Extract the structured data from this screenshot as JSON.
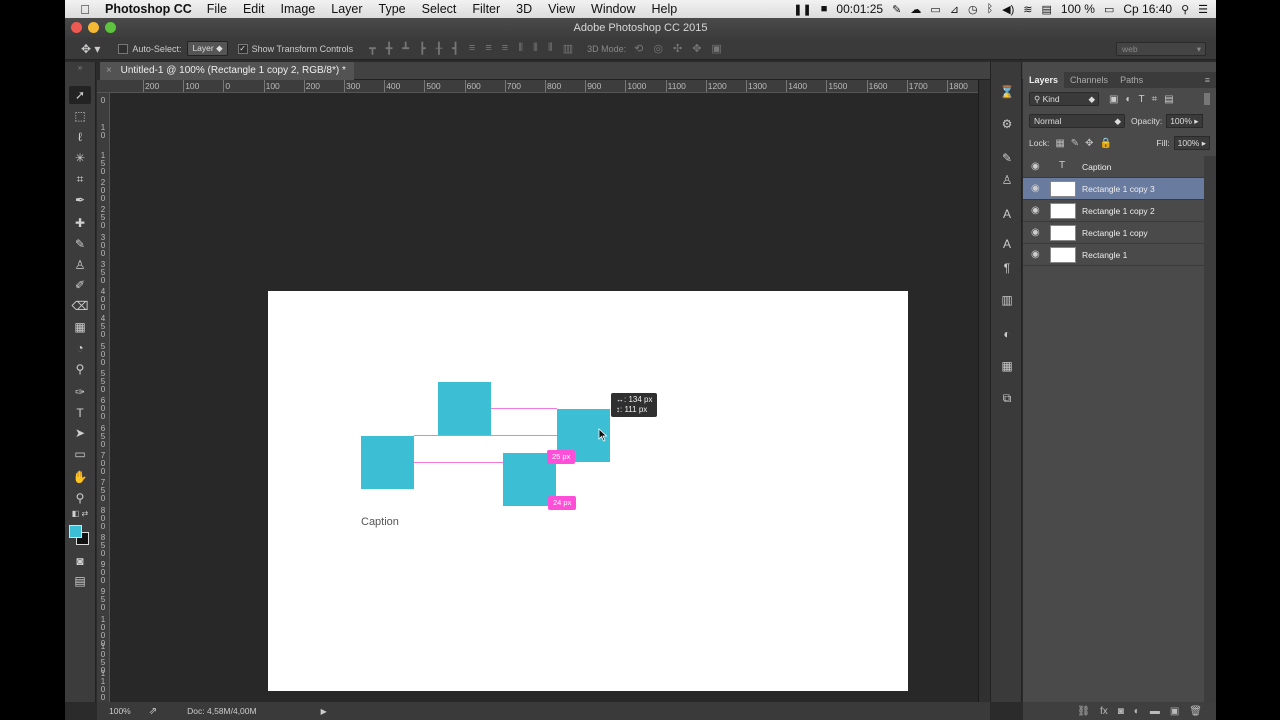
{
  "menubar": {
    "app_name": "Photoshop CC",
    "items": [
      "File",
      "Edit",
      "Image",
      "Layer",
      "Type",
      "Select",
      "Filter",
      "3D",
      "View",
      "Window",
      "Help"
    ],
    "recording_time": "00:01:25",
    "battery": "100 %",
    "clock": "Ср 16:40"
  },
  "window": {
    "title": "Adobe Photoshop CC 2015"
  },
  "options": {
    "auto_select_label": "Auto-Select:",
    "auto_select_value": "Layer",
    "show_transform_label": "Show Transform Controls",
    "mode_3d_label": "3D Mode:",
    "workspace": "web"
  },
  "document": {
    "tab_title": "Untitled-1 @ 100% (Rectangle 1 copy 2, RGB/8*) *",
    "caption": "Caption",
    "measure_h": "25 px",
    "measure_v": "24 px",
    "tooltip_dx": "↔: 134 px",
    "tooltip_dy": "↕: 111 px",
    "rect_color": "#3cbfd4",
    "guide_color": "#f07bdc"
  },
  "ruler": {
    "h_labels": [
      "200",
      "100",
      "0",
      "100",
      "200",
      "300",
      "400",
      "500",
      "600",
      "700",
      "800",
      "900",
      "1000",
      "1100",
      "1200",
      "1300",
      "1400",
      "1500",
      "1600",
      "1700",
      "1800"
    ],
    "v_labels": [
      "0",
      "1\n0",
      "1\n5\n0",
      "2\n0\n0",
      "2\n5\n0",
      "3\n0\n0",
      "3\n5\n0",
      "4\n0\n0",
      "4\n5\n0",
      "5\n0\n0",
      "5\n5\n0",
      "6\n0\n0",
      "6\n5\n0",
      "7\n0\n0",
      "7\n5\n0",
      "8\n0\n0",
      "8\n5\n0",
      "9\n0\n0",
      "9\n5\n0",
      "1\n0\n0\n0",
      "1\n0\n5\n0",
      "1\n1\n0\n0"
    ]
  },
  "status": {
    "zoom": "100%",
    "doc_size": "Doc: 4,58M/4,00M"
  },
  "panel": {
    "tabs": [
      "Layers",
      "Channels",
      "Paths"
    ],
    "filter_label": "Kind",
    "blend_mode": "Normal",
    "opacity_label": "Opacity:",
    "opacity_value": "100%",
    "lock_label": "Lock:",
    "fill_label": "Fill:",
    "fill_value": "100%",
    "layers": [
      {
        "name": "Caption",
        "type": "text"
      },
      {
        "name": "Rectangle 1 copy 3",
        "type": "shape",
        "selected": true
      },
      {
        "name": "Rectangle 1 copy 2",
        "type": "shape"
      },
      {
        "name": "Rectangle 1 copy",
        "type": "shape"
      },
      {
        "name": "Rectangle 1",
        "type": "shape"
      }
    ]
  },
  "colors": {
    "foreground": "#3cbfd4",
    "background": "#111111",
    "selection": "#6a7ba0"
  }
}
